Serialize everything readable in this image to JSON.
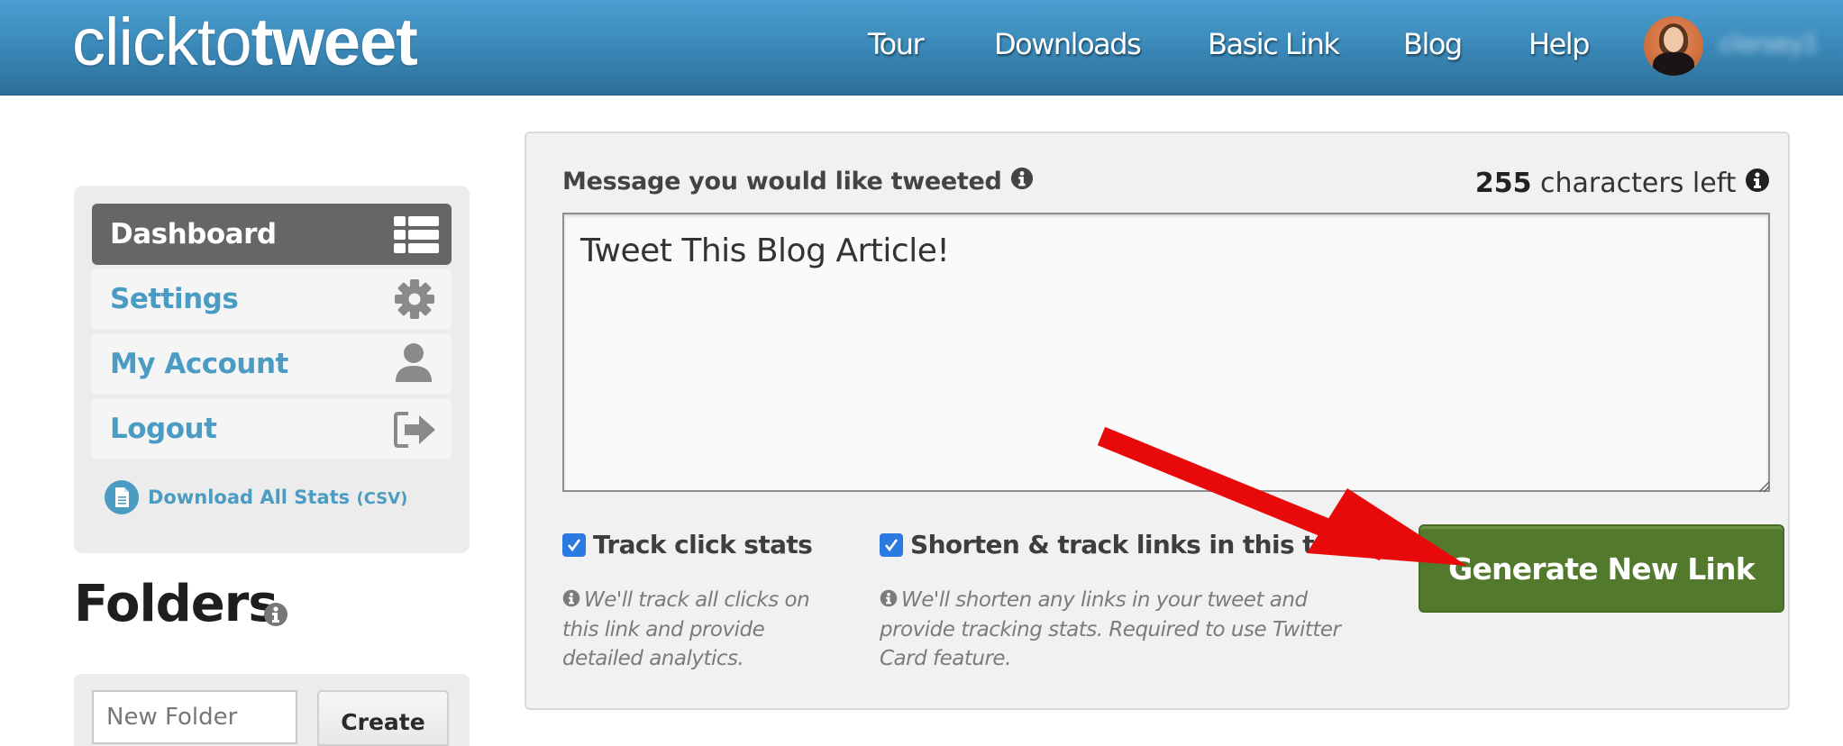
{
  "header": {
    "logo_thin": "clickto",
    "logo_bold": "tweet",
    "nav": [
      {
        "label": "Tour"
      },
      {
        "label": "Downloads"
      },
      {
        "label": "Basic Link"
      },
      {
        "label": "Blog"
      },
      {
        "label": "Help"
      }
    ],
    "username_blurred": "clorsey1"
  },
  "sidebar": {
    "items": [
      {
        "label": "Dashboard",
        "icon": "list-icon",
        "active": true
      },
      {
        "label": "Settings",
        "icon": "gear-icon",
        "active": false
      },
      {
        "label": "My Account",
        "icon": "user-icon",
        "active": false
      },
      {
        "label": "Logout",
        "icon": "sign-out-icon",
        "active": false
      }
    ],
    "download_label": "Download All Stats",
    "download_suffix": "(CSV)"
  },
  "folders": {
    "title": "Folders",
    "input_placeholder": "New Folder",
    "create_label": "Create"
  },
  "composer": {
    "message_label": "Message you would like tweeted",
    "chars_left_count": "255",
    "chars_left_text": "characters left",
    "tweet_text": "Tweet This Blog Article!",
    "track_clicks": {
      "label": "Track click stats",
      "checked": true,
      "hint": "We'll track all clicks on this link and provide detailed analytics."
    },
    "shorten_links": {
      "label": "Shorten & track links in this tweet",
      "checked": true,
      "hint": "We'll shorten any links in your tweet and provide tracking stats. Required to use Twitter Card feature."
    },
    "generate_label": "Generate New Link"
  },
  "colors": {
    "header_blue": "#3a88b8",
    "link_blue": "#4b9cc3",
    "active_gray": "#666666",
    "button_green": "#537a2c",
    "checkbox_blue": "#2a7ae2",
    "annotation_red": "#e8090b"
  }
}
